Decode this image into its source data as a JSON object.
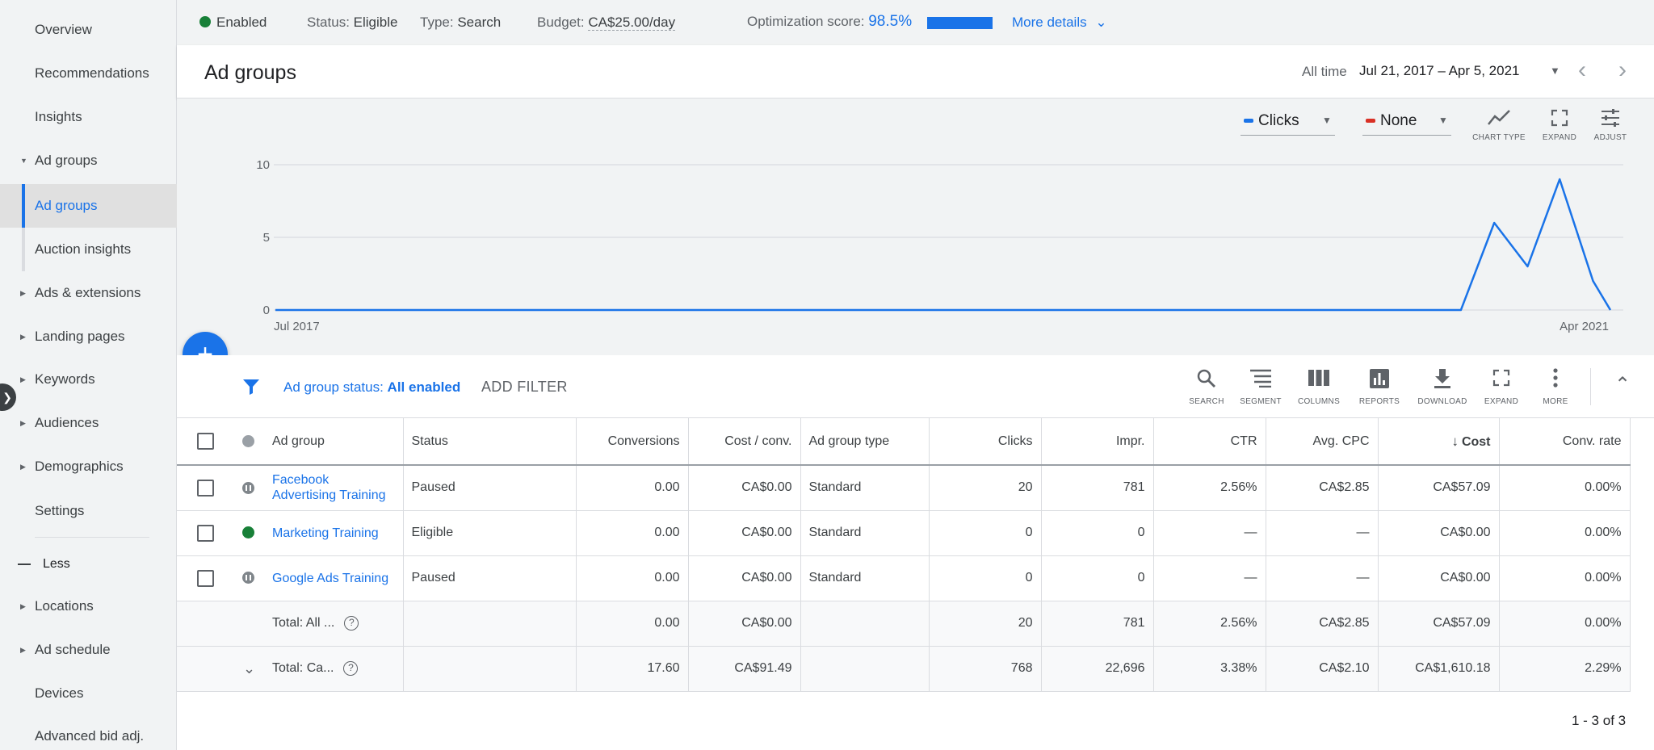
{
  "sidebar": {
    "items": [
      {
        "label": "Overview"
      },
      {
        "label": "Recommendations"
      },
      {
        "label": "Insights"
      },
      {
        "label": "Ad groups"
      },
      {
        "label": "Ad groups"
      },
      {
        "label": "Auction insights"
      },
      {
        "label": "Ads & extensions"
      },
      {
        "label": "Landing pages"
      },
      {
        "label": "Keywords"
      },
      {
        "label": "Audiences"
      },
      {
        "label": "Demographics"
      },
      {
        "label": "Settings"
      },
      {
        "label": "Less"
      },
      {
        "label": "Locations"
      },
      {
        "label": "Ad schedule"
      },
      {
        "label": "Devices"
      },
      {
        "label": "Advanced bid adj."
      }
    ]
  },
  "topbar": {
    "enabled": "Enabled",
    "status_label": "Status:",
    "status_value": "Eligible",
    "type_label": "Type:",
    "type_value": "Search",
    "budget_label": "Budget:",
    "budget_value": "CA$25.00/day",
    "opt_label": "Optimization score:",
    "opt_value": "98.5%",
    "opt_fraction": 0.985,
    "more_details": "More details"
  },
  "header": {
    "title": "Ad groups",
    "range_label": "All time",
    "range_value": "Jul 21, 2017 – Apr 5, 2021"
  },
  "chart_controls": {
    "metric1": "Clicks",
    "metric1_color": "#1a73e8",
    "metric2": "None",
    "metric2_color": "#d93025",
    "tools": [
      "CHART TYPE",
      "EXPAND",
      "ADJUST"
    ]
  },
  "chart_data": {
    "type": "line",
    "y_ticks": [
      "10",
      "5",
      "0"
    ],
    "ylim": [
      0,
      10
    ],
    "x_start_label": "Jul 2017",
    "x_end_label": "Apr 2021",
    "series": [
      {
        "color": "#1a73e8",
        "points": [
          {
            "x": 0.0,
            "y": 0
          },
          {
            "x": 0.888,
            "y": 0
          },
          {
            "x": 0.913,
            "y": 6
          },
          {
            "x": 0.938,
            "y": 3
          },
          {
            "x": 0.962,
            "y": 9
          },
          {
            "x": 0.987,
            "y": 2
          },
          {
            "x": 1.0,
            "y": 0
          }
        ]
      }
    ]
  },
  "filter": {
    "label": "Ad group status:",
    "value": "All enabled",
    "add": "ADD FILTER"
  },
  "toolbar": {
    "tools": [
      "SEARCH",
      "SEGMENT",
      "COLUMNS",
      "REPORTS",
      "DOWNLOAD",
      "EXPAND",
      "MORE"
    ]
  },
  "table": {
    "headers": [
      "Ad group",
      "Status",
      "Conversions",
      "Cost / conv.",
      "Ad group type",
      "Clicks",
      "Impr.",
      "CTR",
      "Avg. CPC",
      "Cost",
      "Conv. rate"
    ],
    "rows": [
      {
        "name": "Facebook Advertising Training",
        "status": "Paused",
        "conversions": "0.00",
        "cost_conv": "CA$0.00",
        "type": "Standard",
        "clicks": "20",
        "impr": "781",
        "ctr": "2.56%",
        "cpc": "CA$2.85",
        "cost": "CA$57.09",
        "conv_rate": "0.00%"
      },
      {
        "name": "Marketing Training",
        "status": "Eligible",
        "conversions": "0.00",
        "cost_conv": "CA$0.00",
        "type": "Standard",
        "clicks": "0",
        "impr": "0",
        "ctr": "—",
        "cpc": "—",
        "cost": "CA$0.00",
        "conv_rate": "0.00%"
      },
      {
        "name": "Google Ads Training",
        "status": "Paused",
        "conversions": "0.00",
        "cost_conv": "CA$0.00",
        "type": "Standard",
        "clicks": "0",
        "impr": "0",
        "ctr": "—",
        "cpc": "—",
        "cost": "CA$0.00",
        "conv_rate": "0.00%"
      }
    ],
    "totals": [
      {
        "name": "Total: All ...",
        "conversions": "0.00",
        "cost_conv": "CA$0.00",
        "clicks": "20",
        "impr": "781",
        "ctr": "2.56%",
        "cpc": "CA$2.85",
        "cost": "CA$57.09",
        "conv_rate": "0.00%"
      },
      {
        "name": "Total: Ca...",
        "conversions": "17.60",
        "cost_conv": "CA$91.49",
        "clicks": "768",
        "impr": "22,696",
        "ctr": "3.38%",
        "cpc": "CA$2.10",
        "cost": "CA$1,610.18",
        "conv_rate": "2.29%"
      }
    ]
  },
  "pager": "1 - 3 of 3"
}
